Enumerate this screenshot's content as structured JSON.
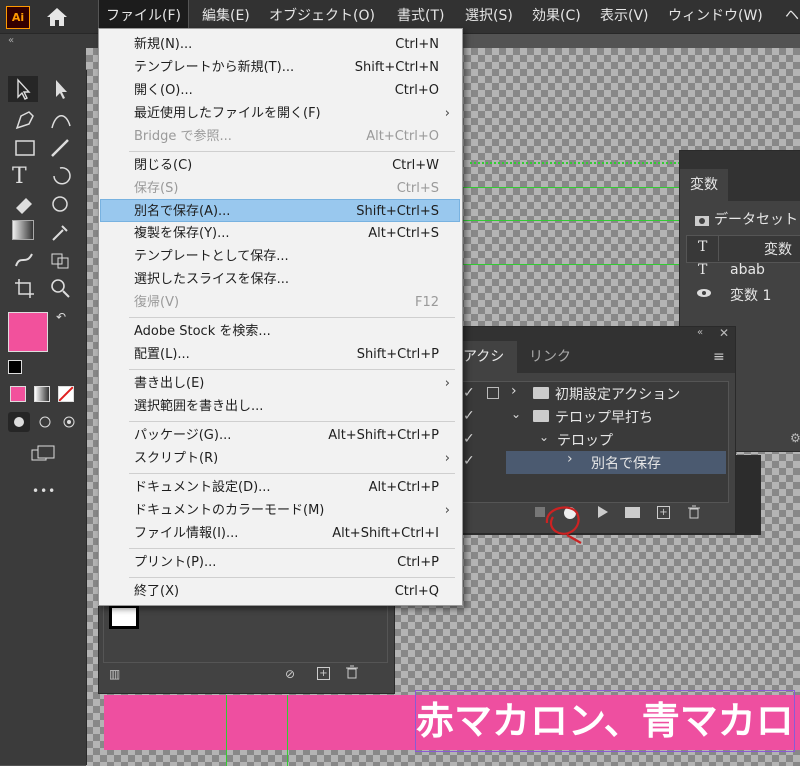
{
  "app": {
    "logo_text": "Ai"
  },
  "menubar": {
    "items": [
      "ファイル(F)",
      "編集(E)",
      "オブジェクト(O)",
      "書式(T)",
      "選択(S)",
      "効果(C)",
      "表示(V)",
      "ウィンドウ(W)",
      "ヘ"
    ]
  },
  "toolbar": {
    "collapse": "«",
    "more": "•••"
  },
  "menu": {
    "items": [
      {
        "label": "新規(N)...",
        "shortcut": "Ctrl+N"
      },
      {
        "label": "テンプレートから新規(T)...",
        "shortcut": "Shift+Ctrl+N"
      },
      {
        "label": "開く(O)...",
        "shortcut": "Ctrl+O"
      },
      {
        "label": "最近使用したファイルを開く(F)",
        "shortcut": "",
        "arrow": "›"
      },
      {
        "label": "Bridge で参照...",
        "shortcut": "Alt+Ctrl+O"
      },
      {
        "label": "閉じる(C)",
        "shortcut": "Ctrl+W"
      },
      {
        "label": "保存(S)",
        "shortcut": "Ctrl+S"
      },
      {
        "label": "別名で保存(A)...",
        "shortcut": "Shift+Ctrl+S"
      },
      {
        "label": "複製を保存(Y)...",
        "shortcut": "Alt+Ctrl+S"
      },
      {
        "label": "テンプレートとして保存...",
        "shortcut": ""
      },
      {
        "label": "選択したスライスを保存...",
        "shortcut": ""
      },
      {
        "label": "復帰(V)",
        "shortcut": "F12"
      },
      {
        "label": "Adobe Stock を検索...",
        "shortcut": ""
      },
      {
        "label": "配置(L)...",
        "shortcut": "Shift+Ctrl+P"
      },
      {
        "label": "書き出し(E)",
        "shortcut": "",
        "arrow": "›"
      },
      {
        "label": "選択範囲を書き出し...",
        "shortcut": ""
      },
      {
        "label": "パッケージ(G)...",
        "shortcut": "Alt+Shift+Ctrl+P"
      },
      {
        "label": "スクリプト(R)",
        "shortcut": "",
        "arrow": "›"
      },
      {
        "label": "ドキュメント設定(D)...",
        "shortcut": "Alt+Ctrl+P"
      },
      {
        "label": "ドキュメントのカラーモード(M)",
        "shortcut": "",
        "arrow": "›"
      },
      {
        "label": "ファイル情報(I)...",
        "shortcut": "Alt+Shift+Ctrl+I"
      },
      {
        "label": "プリント(P)...",
        "shortcut": "Ctrl+P"
      },
      {
        "label": "終了(X)",
        "shortcut": "Ctrl+Q"
      }
    ]
  },
  "variables_panel": {
    "tab": "変数",
    "dataset_label": "データセット",
    "col_header": "変数",
    "rows": [
      {
        "name": "abab"
      },
      {
        "name": "変数 1"
      }
    ]
  },
  "actions_panel": {
    "tab_actions": "アクション",
    "tab_link": "リンク",
    "rows": [
      "初期設定アクション",
      "テロップ早打ち",
      "テロップ",
      "別名で保存"
    ]
  },
  "canvas": {
    "caption_text": "赤マカロン、青マカロ"
  },
  "colors": {
    "fill": "#f2519c",
    "menu_highlight": "#99c8ee",
    "record_circle": "#cc2222"
  }
}
